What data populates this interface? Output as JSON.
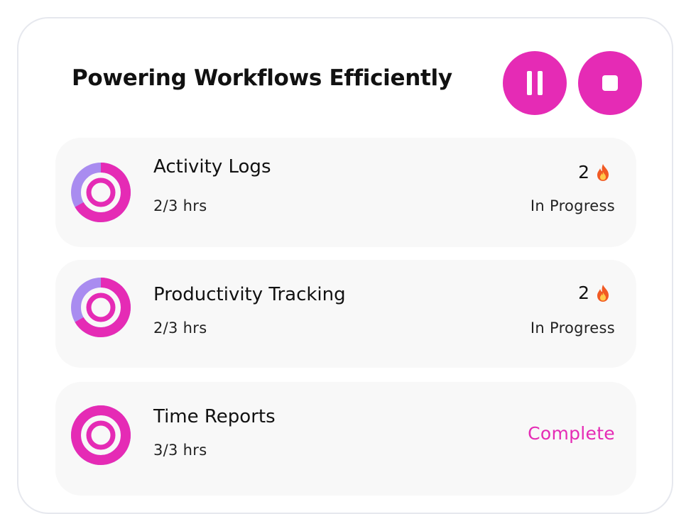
{
  "header": {
    "title": "Powering Workflows Efficiently"
  },
  "controls": {
    "pause_icon": "pause-icon",
    "stop_icon": "stop-icon"
  },
  "colors": {
    "accent": "#e52bb5",
    "progress_remaining": "#a98cf0",
    "row_bg": "#f8f8f8"
  },
  "tasks": [
    {
      "name": "Activity Logs",
      "hours": "2/3 hrs",
      "streak": "2",
      "streak_icon": "fire-icon",
      "status": "In Progress",
      "progress": 0.6667
    },
    {
      "name": "Productivity Tracking",
      "hours": "2/3 hrs",
      "streak": "2",
      "streak_icon": "fire-icon",
      "status": "In Progress",
      "progress": 0.6667
    },
    {
      "name": "Time Reports",
      "hours": "3/3 hrs",
      "status": "Complete",
      "progress": 1.0
    }
  ]
}
